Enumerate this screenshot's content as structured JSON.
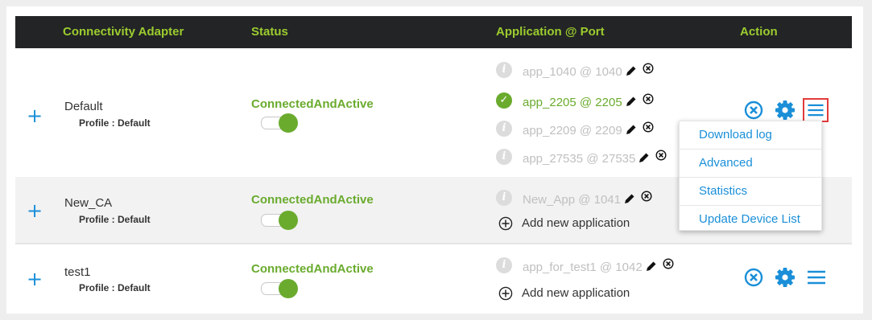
{
  "table": {
    "headers": {
      "connectivity_adapter": "Connectivity Adapter",
      "status": "Status",
      "application_port": "Application @ Port",
      "action": "Action"
    },
    "rows": [
      {
        "name": "Default",
        "profile": "Profile : Default",
        "status": "ConnectedAndActive",
        "toggle_on": true,
        "apps": [
          {
            "label": "app_1040 @ 1040",
            "state": "inactive"
          },
          {
            "label": "app_2205 @ 2205",
            "state": "active"
          },
          {
            "label": "app_2209 @ 2209",
            "state": "inactive"
          },
          {
            "label": "app_27535 @ 27535",
            "state": "inactive"
          }
        ]
      },
      {
        "name": "New_CA",
        "profile": "Profile : Default",
        "status": "ConnectedAndActive",
        "toggle_on": true,
        "apps": [
          {
            "label": "New_App @ 1041",
            "state": "inactive"
          }
        ],
        "add_application": "Add new application"
      },
      {
        "name": "test1",
        "profile": "Profile : Default",
        "status": "ConnectedAndActive",
        "toggle_on": true,
        "apps": [
          {
            "label": "app_for_test1 @ 1042",
            "state": "inactive"
          }
        ],
        "add_application": "Add new application"
      }
    ]
  },
  "dropdown_menu": {
    "items": [
      "Download log",
      "Advanced",
      "Statistics",
      "Update Device List"
    ]
  },
  "icons": {
    "expand": "plus-icon",
    "info": "info-icon",
    "active": "check-circle-icon",
    "edit": "pencil-icon",
    "remove": "remove-circle-icon",
    "add": "add-circle-icon",
    "action_cancel": "cancel-circle-icon",
    "action_settings": "gear-icon",
    "action_menu": "hamburger-menu-icon"
  },
  "colors": {
    "header_bg": "#222426",
    "header_text": "#9ccc2e",
    "status_green": "#6aab2e",
    "action_blue": "#1a8fd8",
    "highlight_red": "#e23b3b",
    "inactive_text": "#c0c0c0"
  }
}
